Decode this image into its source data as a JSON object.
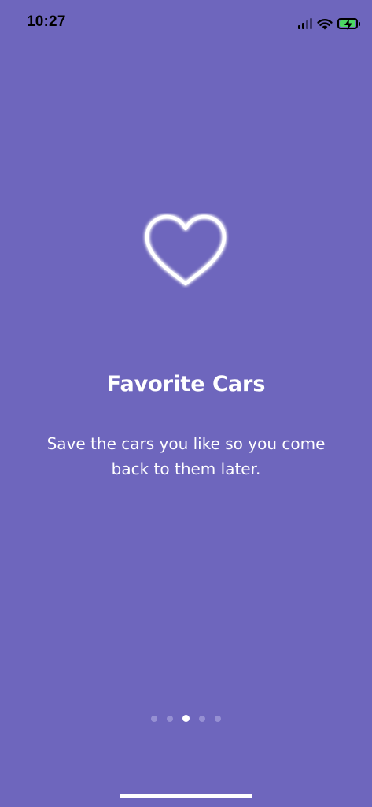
{
  "colors": {
    "background": "#6e66bd",
    "foreground": "#ffffff",
    "status_text": "#000000",
    "battery_green": "#4cd964",
    "signal_dim": "#3a356b",
    "dot_inactive": "#9690d3",
    "dot_active": "#ffffff"
  },
  "status_bar": {
    "time": "10:27",
    "signal_bars_active": 2,
    "signal_bars_total": 4,
    "wifi_icon": "wifi-icon",
    "battery_icon": "battery-charging-icon"
  },
  "onboarding": {
    "icon": "heart-icon",
    "title": "Favorite Cars",
    "description": "Save the cars you like so you come back to them later."
  },
  "pager": {
    "page_count": 5,
    "current_page": 3
  }
}
